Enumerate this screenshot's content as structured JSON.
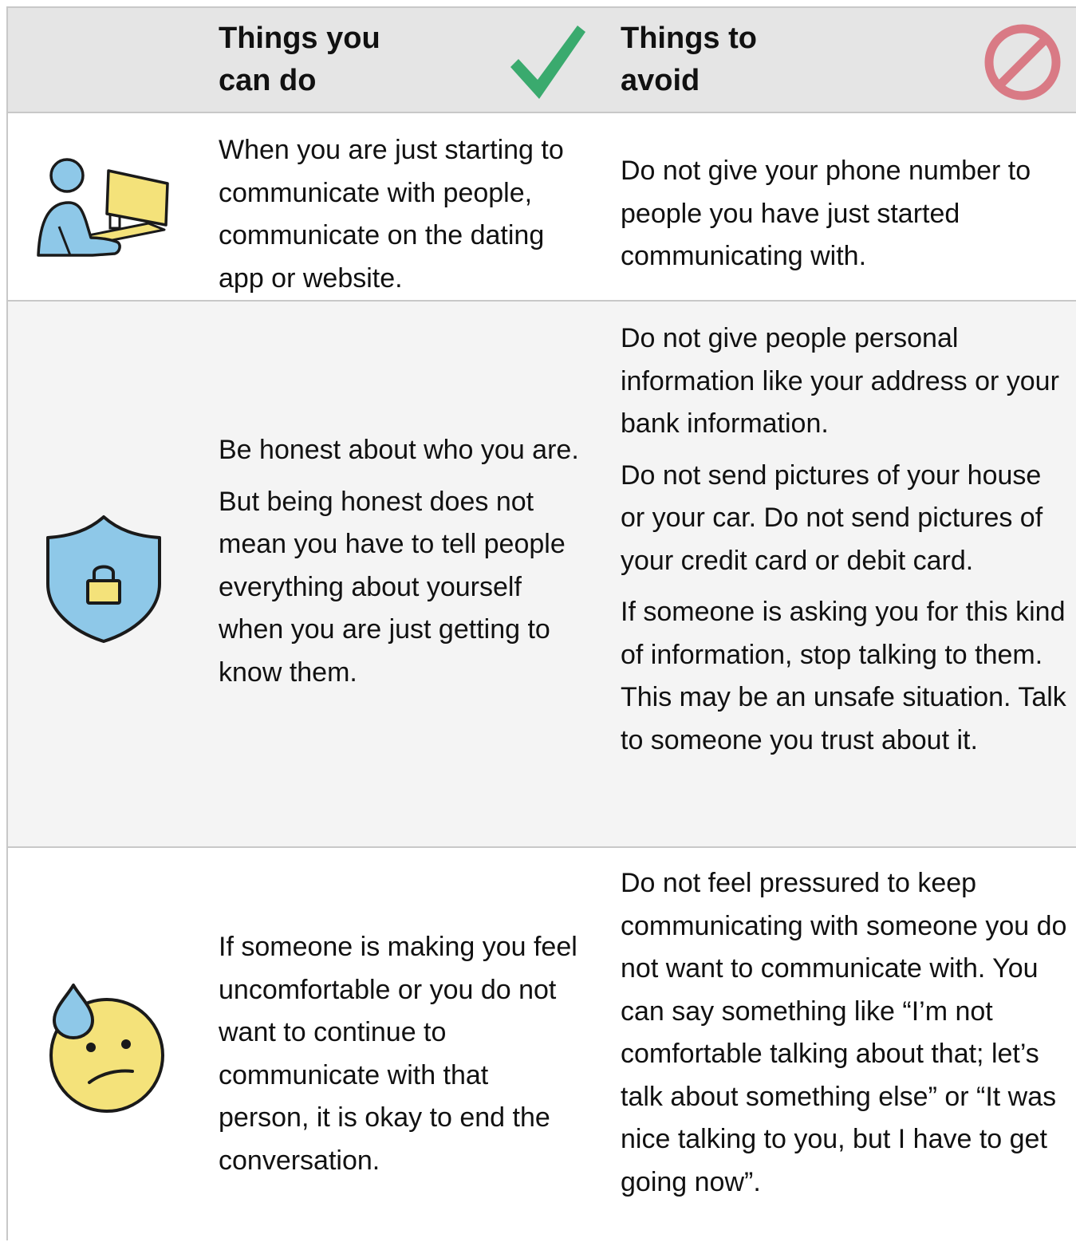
{
  "header": {
    "do_title": [
      "Things you",
      "can do"
    ],
    "avoid_title": [
      "Things to",
      "avoid"
    ],
    "do_icon": "checkmark-icon",
    "avoid_icon": "prohibited-icon"
  },
  "rows": [
    {
      "icon": "person-at-computer-icon",
      "do": [
        "When you are just starting to communicate with people, communicate on the dating app or website."
      ],
      "avoid": [
        "Do not give your phone number to people you have just started communicating with."
      ]
    },
    {
      "icon": "shield-lock-icon",
      "do": [
        "Be honest about who you are.",
        "But being honest does not mean you have to tell people everything about yourself when you are just getting to know them."
      ],
      "avoid": [
        "Do not give people personal information like your address or your bank information.",
        "Do not send pictures of your house or your car. Do not send pictures of your credit card or debit card.",
        "If someone is asking you for this kind of information, stop talking to them. This may be an unsafe situation. Talk to someone you trust about it."
      ]
    },
    {
      "icon": "worried-face-sweat-icon",
      "do": [
        "If someone is making you feel uncomfortable or you do not want to continue to communicate with that person, it is okay to end the conversation."
      ],
      "avoid": [
        "Do not feel pressured to keep communicating with someone you do not want to communicate with. You can say something like “I’m not comfortable talking about that; let’s talk about something else” or “It was nice talking to you, but I have to get going now”."
      ]
    }
  ],
  "colors": {
    "check": "#3aaa6e",
    "prohibit": "#d97a85",
    "blue": "#8ec8e8",
    "yellow": "#f4e27a",
    "header_bg": "#e5e5e5",
    "alt_row_bg": "#f4f4f4"
  }
}
